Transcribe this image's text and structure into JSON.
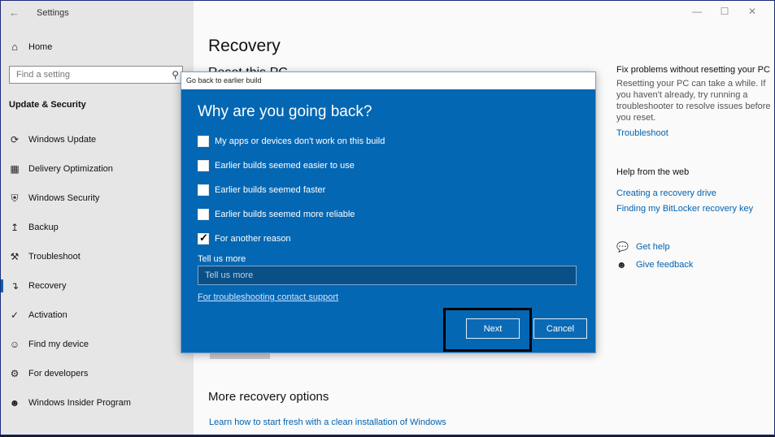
{
  "window": {
    "title": "Settings",
    "controls": [
      "—",
      "☐",
      "✕"
    ]
  },
  "nav": {
    "back_icon": "back-arrow-icon",
    "home_label": "Home",
    "search_placeholder": "Find a setting",
    "section": "Update & Security",
    "items": [
      {
        "label": "Windows Update",
        "icon": "sync-icon"
      },
      {
        "label": "Delivery Optimization",
        "icon": "delivery-icon"
      },
      {
        "label": "Windows Security",
        "icon": "shield-icon"
      },
      {
        "label": "Backup",
        "icon": "backup-icon"
      },
      {
        "label": "Troubleshoot",
        "icon": "wrench-icon"
      },
      {
        "label": "Recovery",
        "icon": "recovery-icon"
      },
      {
        "label": "Activation",
        "icon": "activation-icon"
      },
      {
        "label": "Find my device",
        "icon": "person-icon"
      },
      {
        "label": "For developers",
        "icon": "developer-icon"
      },
      {
        "label": "Windows Insider Program",
        "icon": "insider-icon"
      }
    ]
  },
  "main": {
    "title": "Recovery",
    "behind_heading": "Reset this PC",
    "more_heading": "More recovery options",
    "more_link": "Learn how to start fresh with a clean installation of Windows"
  },
  "right": {
    "fix_heading": "Fix problems without resetting your PC",
    "fix_text": "Resetting your PC can take a while. If you haven't already, try running a troubleshooter to resolve issues before you reset.",
    "troubleshoot_link": "Troubleshoot",
    "web_heading": "Help from the web",
    "web_links": [
      "Creating a recovery drive",
      "Finding my BitLocker recovery key"
    ],
    "get_help": "Get help",
    "give_feedback": "Give feedback"
  },
  "dialog": {
    "title": "Go back to earlier build",
    "heading": "Why are you going back?",
    "options": [
      {
        "label": "My apps or devices don't work on this build",
        "checked": false
      },
      {
        "label": "Earlier builds seemed easier to use",
        "checked": false
      },
      {
        "label": "Earlier builds seemed faster",
        "checked": false
      },
      {
        "label": "Earlier builds seemed more reliable",
        "checked": false
      },
      {
        "label": "For another reason",
        "checked": true
      }
    ],
    "more_label": "Tell us more",
    "more_placeholder": "Tell us more",
    "support_link": "For troubleshooting contact support",
    "next": "Next",
    "cancel": "Cancel"
  }
}
